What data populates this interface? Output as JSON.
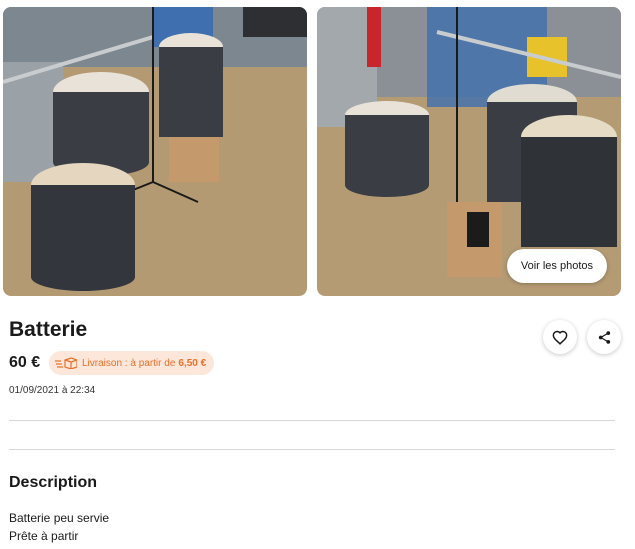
{
  "gallery": {
    "view_photos_label": "Voir les photos"
  },
  "listing": {
    "title": "Batterie",
    "price": "60 €",
    "delivery_prefix": "Livraison : à partir de",
    "delivery_amount": "6,50 €",
    "date": "01/09/2021 à 22:34"
  },
  "description": {
    "heading": "Description",
    "lines": [
      "Batterie peu servie",
      "Prête à partir"
    ]
  },
  "icons": {
    "favorite": "heart-icon",
    "share": "share-icon",
    "delivery": "parcel-delivery-icon"
  },
  "colors": {
    "delivery_text": "#e8702a",
    "delivery_bg": "#fde6da"
  }
}
